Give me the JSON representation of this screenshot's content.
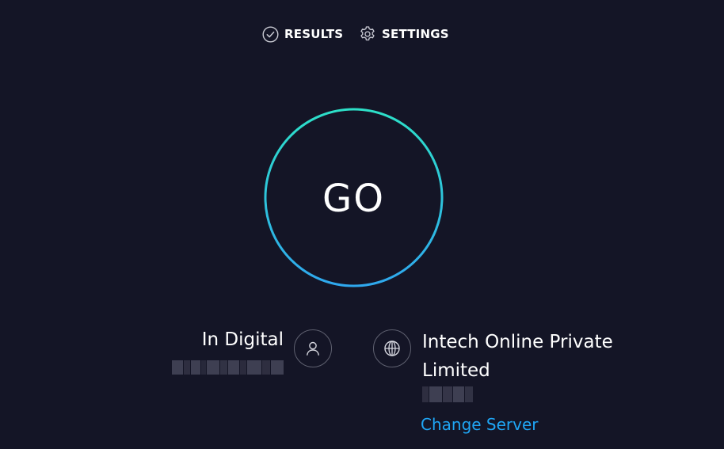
{
  "nav": {
    "results_label": "RESULTS",
    "settings_label": "SETTINGS",
    "results_icon": "check-circle-icon",
    "settings_icon": "gear-icon"
  },
  "go_button": {
    "label": "GO",
    "ring_gradient": [
      "#2de0c8",
      "#2fa8ee"
    ]
  },
  "provider": {
    "name": "In Digital",
    "icon": "user-icon"
  },
  "server": {
    "name": "Intech Online Private Limited",
    "icon": "globe-icon",
    "change_label": "Change Server"
  },
  "colors": {
    "background": "#141526",
    "accent_link": "#1fa6f5",
    "icon_border": "#5f6170"
  }
}
